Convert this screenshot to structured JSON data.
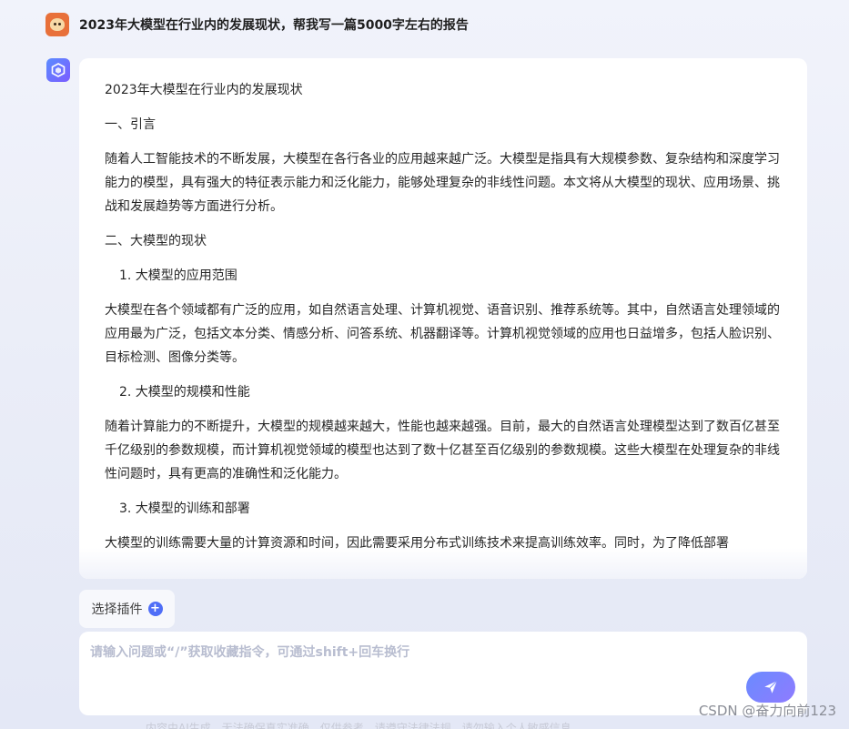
{
  "user_message": {
    "text": "2023年大模型在行业内的发展现状，帮我写一篇5000字左右的报告"
  },
  "answer": {
    "title": "2023年大模型在行业内的发展现状",
    "section1_heading": "一、引言",
    "section1_paragraph": "随着人工智能技术的不断发展，大模型在各行各业的应用越来越广泛。大模型是指具有大规模参数、复杂结构和深度学习能力的模型，具有强大的特征表示能力和泛化能力，能够处理复杂的非线性问题。本文将从大模型的现状、应用场景、挑战和发展趋势等方面进行分析。",
    "section2_heading": "二、大模型的现状",
    "sub1_heading": "1. 大模型的应用范围",
    "sub1_paragraph": "大模型在各个领域都有广泛的应用，如自然语言处理、计算机视觉、语音识别、推荐系统等。其中，自然语言处理领域的应用最为广泛，包括文本分类、情感分析、问答系统、机器翻译等。计算机视觉领域的应用也日益增多，包括人脸识别、目标检测、图像分类等。",
    "sub2_heading": "2. 大模型的规模和性能",
    "sub2_paragraph": "随着计算能力的不断提升，大模型的规模越来越大，性能也越来越强。目前，最大的自然语言处理模型达到了数百亿甚至千亿级别的参数规模，而计算机视觉领域的模型也达到了数十亿甚至百亿级别的参数规模。这些大模型在处理复杂的非线性问题时，具有更高的准确性和泛化能力。",
    "sub3_heading": "3. 大模型的训练和部署",
    "sub3_paragraph": "大模型的训练需要大量的计算资源和时间，因此需要采用分布式训练技术来提高训练效率。同时，为了降低部署"
  },
  "plugin_button": {
    "label": "选择插件"
  },
  "input": {
    "placeholder": "请输入问题或“/”获取收藏指令，可通过shift+回车换行",
    "value": ""
  },
  "footer": {
    "disclaimer": "内容由AI生成，无法确保真实准确，仅供参考，请遵守法律法规，请勿输入个人敏感信息"
  },
  "watermark": "CSDN @奋力向前123",
  "icons": {
    "user_avatar": "lion-avatar-icon",
    "bot_avatar": "cube-logo-icon",
    "plugin_add": "plus-circle-icon",
    "send": "paper-plane-icon"
  },
  "colors": {
    "accent": "#4f6ef7",
    "send_gradient_start": "#6a8bff",
    "send_gradient_end": "#8f7bff",
    "user_avatar_bg": "#e8703a"
  }
}
